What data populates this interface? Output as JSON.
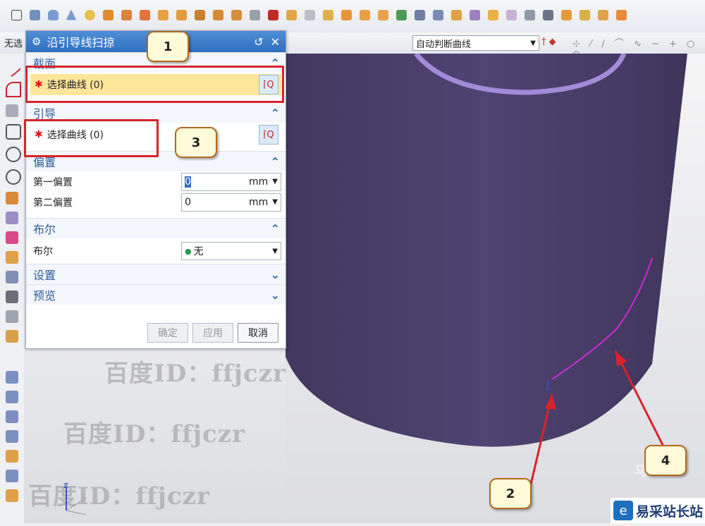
{
  "dialog": {
    "title": "沿引导线扫掠",
    "sections": {
      "section": {
        "label": "截面",
        "select_label": "选择曲线 (0)"
      },
      "guide": {
        "label": "引导",
        "select_label": "选择曲线 (0)"
      },
      "offset": {
        "label": "偏置",
        "first_label": "第一偏置",
        "first_value": "0",
        "first_unit": "mm",
        "second_label": "第二偏置",
        "second_value": "0",
        "second_unit": "mm"
      },
      "boolean": {
        "label": "布尔",
        "field_label": "布尔",
        "value": "无"
      },
      "settings": {
        "label": "设置"
      },
      "preview": {
        "label": "预览"
      }
    },
    "buttons": {
      "ok": "确定",
      "apply": "应用",
      "cancel": "取消"
    }
  },
  "toolbar": {
    "filter_label": "无选",
    "curve_rule": "自动判断曲线"
  },
  "watermarks": [
    "百度ID：ffjczr",
    "百度ID：ffjczr",
    "百度ID：ffjczr"
  ],
  "callouts": [
    "1",
    "2",
    "3",
    "4"
  ],
  "brand": {
    "name": "易采站长站",
    "logo_char": "e"
  },
  "colors": {
    "cylinder": "#4b3f6b",
    "curve": "#cc2bd6",
    "callout_border": "#d8232a"
  }
}
